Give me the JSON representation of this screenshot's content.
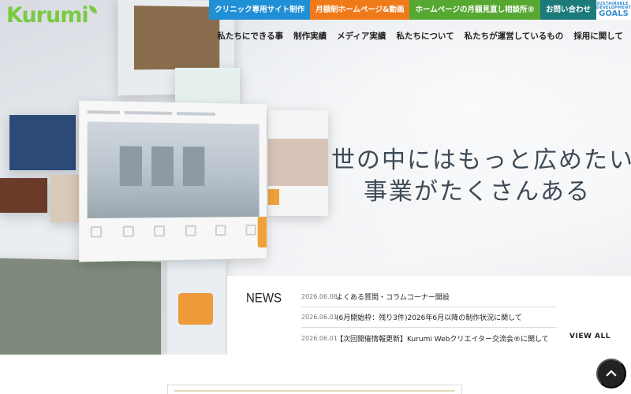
{
  "brand": {
    "name": "Kurumi",
    "color": "#7ac943"
  },
  "topbar": {
    "items": [
      {
        "label": "クリニック専用サイト制作",
        "color": "#1f8fd6"
      },
      {
        "label": "月額制ホームページ&動画",
        "color": "#ef7a1a"
      },
      {
        "label": "ホームページの月額見直し相談所®",
        "color": "#57a832"
      },
      {
        "label": "お問い合わせ",
        "color": "#1c7a7a"
      }
    ],
    "sdg": {
      "line1": "SUSTAINABLE DEVELOPMENT",
      "line2": "GOALS"
    }
  },
  "nav": {
    "items": [
      "私たちにできる事",
      "制作実績",
      "メディア実績",
      "私たちについて",
      "私たちが運営しているもの",
      "採用に関して"
    ]
  },
  "hero": {
    "line1": "世の中にはもっと広めたい",
    "line2": "事業がたくさんある"
  },
  "news": {
    "title": "NEWS",
    "items": [
      {
        "date": "2026.06.08",
        "text": "よくある質問・コラムコーナー開設"
      },
      {
        "date": "2026.06.01",
        "text": "(6月開始枠：残り3件)2026年6月以降の制作状況に関して"
      },
      {
        "date": "2026.06.01",
        "text": "【次回開催情報更新】Kurumi Webクリエイター交流会®に関して"
      }
    ],
    "view_all": "VIEW ALL"
  }
}
